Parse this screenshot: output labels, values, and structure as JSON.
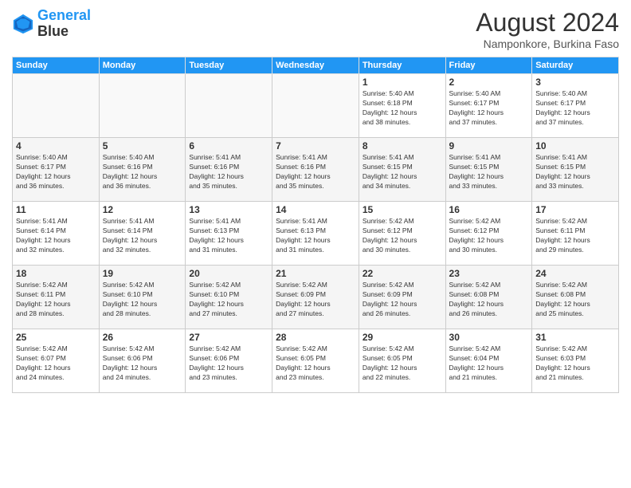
{
  "header": {
    "logo_line1": "General",
    "logo_line2": "Blue",
    "month": "August 2024",
    "location": "Namponkore, Burkina Faso"
  },
  "weekdays": [
    "Sunday",
    "Monday",
    "Tuesday",
    "Wednesday",
    "Thursday",
    "Friday",
    "Saturday"
  ],
  "weeks": [
    [
      {
        "day": "",
        "info": "",
        "empty": true
      },
      {
        "day": "",
        "info": "",
        "empty": true
      },
      {
        "day": "",
        "info": "",
        "empty": true
      },
      {
        "day": "",
        "info": "",
        "empty": true
      },
      {
        "day": "1",
        "info": "Sunrise: 5:40 AM\nSunset: 6:18 PM\nDaylight: 12 hours\nand 38 minutes."
      },
      {
        "day": "2",
        "info": "Sunrise: 5:40 AM\nSunset: 6:17 PM\nDaylight: 12 hours\nand 37 minutes."
      },
      {
        "day": "3",
        "info": "Sunrise: 5:40 AM\nSunset: 6:17 PM\nDaylight: 12 hours\nand 37 minutes."
      }
    ],
    [
      {
        "day": "4",
        "info": "Sunrise: 5:40 AM\nSunset: 6:17 PM\nDaylight: 12 hours\nand 36 minutes.",
        "shaded": true
      },
      {
        "day": "5",
        "info": "Sunrise: 5:40 AM\nSunset: 6:16 PM\nDaylight: 12 hours\nand 36 minutes.",
        "shaded": true
      },
      {
        "day": "6",
        "info": "Sunrise: 5:41 AM\nSunset: 6:16 PM\nDaylight: 12 hours\nand 35 minutes.",
        "shaded": true
      },
      {
        "day": "7",
        "info": "Sunrise: 5:41 AM\nSunset: 6:16 PM\nDaylight: 12 hours\nand 35 minutes.",
        "shaded": true
      },
      {
        "day": "8",
        "info": "Sunrise: 5:41 AM\nSunset: 6:15 PM\nDaylight: 12 hours\nand 34 minutes.",
        "shaded": true
      },
      {
        "day": "9",
        "info": "Sunrise: 5:41 AM\nSunset: 6:15 PM\nDaylight: 12 hours\nand 33 minutes.",
        "shaded": true
      },
      {
        "day": "10",
        "info": "Sunrise: 5:41 AM\nSunset: 6:15 PM\nDaylight: 12 hours\nand 33 minutes.",
        "shaded": true
      }
    ],
    [
      {
        "day": "11",
        "info": "Sunrise: 5:41 AM\nSunset: 6:14 PM\nDaylight: 12 hours\nand 32 minutes."
      },
      {
        "day": "12",
        "info": "Sunrise: 5:41 AM\nSunset: 6:14 PM\nDaylight: 12 hours\nand 32 minutes."
      },
      {
        "day": "13",
        "info": "Sunrise: 5:41 AM\nSunset: 6:13 PM\nDaylight: 12 hours\nand 31 minutes."
      },
      {
        "day": "14",
        "info": "Sunrise: 5:41 AM\nSunset: 6:13 PM\nDaylight: 12 hours\nand 31 minutes."
      },
      {
        "day": "15",
        "info": "Sunrise: 5:42 AM\nSunset: 6:12 PM\nDaylight: 12 hours\nand 30 minutes."
      },
      {
        "day": "16",
        "info": "Sunrise: 5:42 AM\nSunset: 6:12 PM\nDaylight: 12 hours\nand 30 minutes."
      },
      {
        "day": "17",
        "info": "Sunrise: 5:42 AM\nSunset: 6:11 PM\nDaylight: 12 hours\nand 29 minutes."
      }
    ],
    [
      {
        "day": "18",
        "info": "Sunrise: 5:42 AM\nSunset: 6:11 PM\nDaylight: 12 hours\nand 28 minutes.",
        "shaded": true
      },
      {
        "day": "19",
        "info": "Sunrise: 5:42 AM\nSunset: 6:10 PM\nDaylight: 12 hours\nand 28 minutes.",
        "shaded": true
      },
      {
        "day": "20",
        "info": "Sunrise: 5:42 AM\nSunset: 6:10 PM\nDaylight: 12 hours\nand 27 minutes.",
        "shaded": true
      },
      {
        "day": "21",
        "info": "Sunrise: 5:42 AM\nSunset: 6:09 PM\nDaylight: 12 hours\nand 27 minutes.",
        "shaded": true
      },
      {
        "day": "22",
        "info": "Sunrise: 5:42 AM\nSunset: 6:09 PM\nDaylight: 12 hours\nand 26 minutes.",
        "shaded": true
      },
      {
        "day": "23",
        "info": "Sunrise: 5:42 AM\nSunset: 6:08 PM\nDaylight: 12 hours\nand 26 minutes.",
        "shaded": true
      },
      {
        "day": "24",
        "info": "Sunrise: 5:42 AM\nSunset: 6:08 PM\nDaylight: 12 hours\nand 25 minutes.",
        "shaded": true
      }
    ],
    [
      {
        "day": "25",
        "info": "Sunrise: 5:42 AM\nSunset: 6:07 PM\nDaylight: 12 hours\nand 24 minutes."
      },
      {
        "day": "26",
        "info": "Sunrise: 5:42 AM\nSunset: 6:06 PM\nDaylight: 12 hours\nand 24 minutes."
      },
      {
        "day": "27",
        "info": "Sunrise: 5:42 AM\nSunset: 6:06 PM\nDaylight: 12 hours\nand 23 minutes."
      },
      {
        "day": "28",
        "info": "Sunrise: 5:42 AM\nSunset: 6:05 PM\nDaylight: 12 hours\nand 23 minutes."
      },
      {
        "day": "29",
        "info": "Sunrise: 5:42 AM\nSunset: 6:05 PM\nDaylight: 12 hours\nand 22 minutes."
      },
      {
        "day": "30",
        "info": "Sunrise: 5:42 AM\nSunset: 6:04 PM\nDaylight: 12 hours\nand 21 minutes."
      },
      {
        "day": "31",
        "info": "Sunrise: 5:42 AM\nSunset: 6:03 PM\nDaylight: 12 hours\nand 21 minutes."
      }
    ]
  ]
}
